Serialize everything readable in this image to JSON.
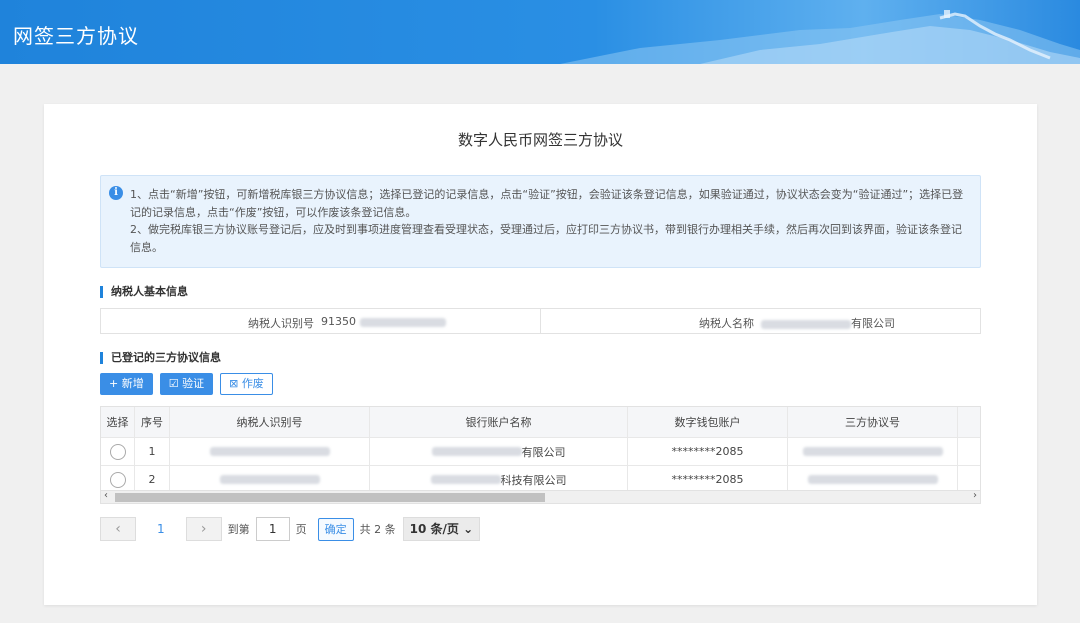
{
  "header": {
    "title": "网签三方协议"
  },
  "page": {
    "title": "数字人民币网签三方协议"
  },
  "notice": {
    "icon": "info-icon",
    "line1": "1、点击“新增”按钮，可新增税库银三方协议信息；选择已登记的记录信息，点击“验证”按钮，会验证该条登记信息，如果验证通过，协议状态会变为“验证通过”；选择已登记的记录信息，点击“作废”按钮，可以作废该条登记信息。",
    "line2": "2、做完税库银三方协议账号登记后，应及时到事项进度管理查看受理状态，受理通过后，应打印三方协议书，带到银行办理相关手续，然后再次回到该界面，验证该条登记信息。"
  },
  "taxpayer_section": {
    "title": "纳税人基本信息",
    "id_label": "纳税人识别号",
    "id_value_prefix": "91350",
    "name_label": "纳税人名称",
    "name_value_suffix": "有限公司"
  },
  "registered_section": {
    "title": "已登记的三方协议信息",
    "buttons": {
      "add": "+ 新增",
      "verify": "验证",
      "void": "作废"
    }
  },
  "table": {
    "columns": [
      "选择",
      "序号",
      "纳税人识别号",
      "银行账户名称",
      "数字钱包账户",
      "三方协议号"
    ],
    "rows": [
      {
        "seq": "1",
        "account_suffix": "有限公司",
        "wallet": "********2085"
      },
      {
        "seq": "2",
        "account_suffix": "科技有限公司",
        "wallet": "********2085"
      }
    ]
  },
  "pager": {
    "current": "1",
    "goto_label": "到第",
    "goto_value": "1",
    "page_unit": "页",
    "confirm": "确定",
    "total": "共 2 条",
    "page_size": "10 条/页"
  },
  "colors": {
    "brand": "#1f83db",
    "accent": "#3a8ee6"
  }
}
